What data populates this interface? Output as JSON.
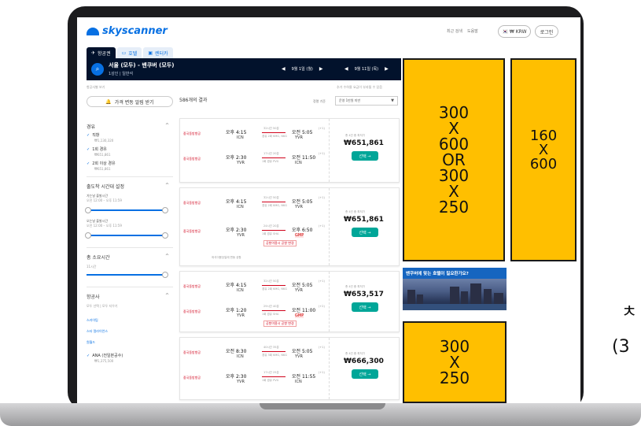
{
  "side_labels": [
    "ㅊ",
    "(3"
  ],
  "header": {
    "logo_text": "skyscanner",
    "links": [
      "최근 검색",
      "도움말"
    ],
    "currency": "🇰🇷 ₩ KRW",
    "login": "로그인"
  },
  "tabs": [
    {
      "icon": "plane-icon",
      "label": "항공권"
    },
    {
      "icon": "bed-icon",
      "label": "호텔"
    },
    {
      "icon": "car-icon",
      "label": "렌터카"
    }
  ],
  "search": {
    "route": "서울 (모두) - 밴쿠버 (모두)",
    "pax": "1성인 | 일반석",
    "dep_date": "9월 1일 (월)",
    "ret_date": "9월 11일 (목)"
  },
  "sub_notes": [
    "항공사별 보기",
    "추가 수하물 요금이 부과될 수 있음"
  ],
  "filters": {
    "alert_btn": "가격 변동 알림 받기",
    "stops_title": "경유",
    "stops": [
      {
        "label": "직항",
        "price": "₩1,130,320"
      },
      {
        "label": "1회 경유",
        "price": "₩651,861"
      },
      {
        "label": "2회 이상 경유",
        "price": "₩651,861"
      }
    ],
    "time_title": "출도착 시간대 설정",
    "outbound_label": "가는날 출발시간",
    "outbound_range": "오전 12:00 – 오후 11:59",
    "inbound_label": "오는날 출발시간",
    "inbound_range": "오전 12:00 – 오후 11:59",
    "duration_title": "총 소요시간",
    "duration_value": "11시간",
    "airlines_title": "항공사",
    "airlines_links": [
      "모두 선택",
      "모두 지우기"
    ],
    "airlines": [
      "스카이팀",
      "스타 얼라이언스",
      "원월드",
      "ANA (전일본공수)"
    ],
    "airline_price": "₩1,375,500"
  },
  "results": {
    "count": "586",
    "count_label": "개의 결과",
    "sort_label": "정렬 기준",
    "sort_value": "운영 1만원 미만"
  },
  "cards": [
    {
      "price_note": "총 4건 중 최저가",
      "price": "₩651,861",
      "select": "선택 →",
      "legs": [
        {
          "airline": "중국동방항공",
          "dep": "오후 4:15",
          "arr": "오전 5:05",
          "arr_sup": "(+1)",
          "from": "ICN",
          "to": "YVR",
          "dur": "32시간 50분",
          "stops": "경유 2회 KMG, NKG"
        },
        {
          "airline": "중국동방항공",
          "dep": "오후 2:30",
          "arr": "오전 11:50",
          "arr_sup": "(+1)",
          "from": "YVR",
          "to": "ICN",
          "dur": "17시간 20분",
          "stops": "1회 경유 PVG"
        }
      ]
    },
    {
      "price_note": "총 4건 중 최저가",
      "price": "₩651,861",
      "select": "선택 →",
      "legs": [
        {
          "airline": "중국동방항공",
          "dep": "오후 4:15",
          "arr": "오전 5:05",
          "arr_sup": "(+1)",
          "from": "ICN",
          "to": "YVR",
          "dur": "32시간 50분",
          "stops": "경유 2회 KMG, NKG"
        },
        {
          "airline": "중국동방항공",
          "dep": "오후 2:30",
          "arr": "오후 6:50",
          "arr_sup": "(+1)",
          "from": "YVR",
          "to": "GMP",
          "dur": "24시간 20분",
          "stops": "1회 경유 SHA",
          "warn": "공항이용시 공항 변경"
        }
      ],
      "extra": "좌석이용당일에 변동 공항"
    },
    {
      "price_note": "총 4건 중 최저가",
      "price": "₩653,517",
      "select": "선택 →",
      "legs": [
        {
          "airline": "중국동방항공",
          "dep": "오후 4:15",
          "arr": "오전 5:05",
          "arr_sup": "(+1)",
          "from": "ICN",
          "to": "YVR",
          "dur": "32시간 50분",
          "stops": "경유 2회 KMG, NKG"
        },
        {
          "airline": "중국동방항공",
          "dep": "오후 1:20",
          "arr": "오전 11:00",
          "arr_sup": "(+2)",
          "from": "YVR",
          "to": "GMP",
          "dur": "29시간 40분",
          "stops": "1회 경유 SHA",
          "warn": "공항이용시 공항 변경"
        }
      ]
    },
    {
      "price_note": "총 4건 중 최저가",
      "price": "₩666,300",
      "select": "선택 →",
      "legs": [
        {
          "airline": "중국동방항공",
          "dep": "오전 8:30",
          "arr": "오전 5:05",
          "arr_sup": "(+1)",
          "from": "ICN",
          "to": "YVR",
          "dur": "40시간 35분",
          "stops": "경유 3회 KMG, NKG"
        },
        {
          "airline": "중국동방항공",
          "dep": "오후 2:30",
          "arr": "오전 11:55",
          "arr_sup": "(+1)",
          "from": "YVR",
          "to": "ICN",
          "dur": "17시간 25분",
          "stops": "1회 경유 PVG"
        }
      ]
    }
  ],
  "ads": {
    "big": [
      "300",
      "X",
      "600",
      "OR",
      "300",
      "X",
      "250"
    ],
    "skyscraper": [
      "160",
      "X",
      "600"
    ],
    "small": [
      "300",
      "X",
      "250"
    ],
    "hotel_headline": "밴쿠버에 맞는 호텔이 필요한가요?"
  },
  "colors": {
    "brand": "#0770e3",
    "navy": "#02122c",
    "ad_fill": "#ffbf00",
    "select_green": "#00a698",
    "warn_red": "#d0021b"
  }
}
